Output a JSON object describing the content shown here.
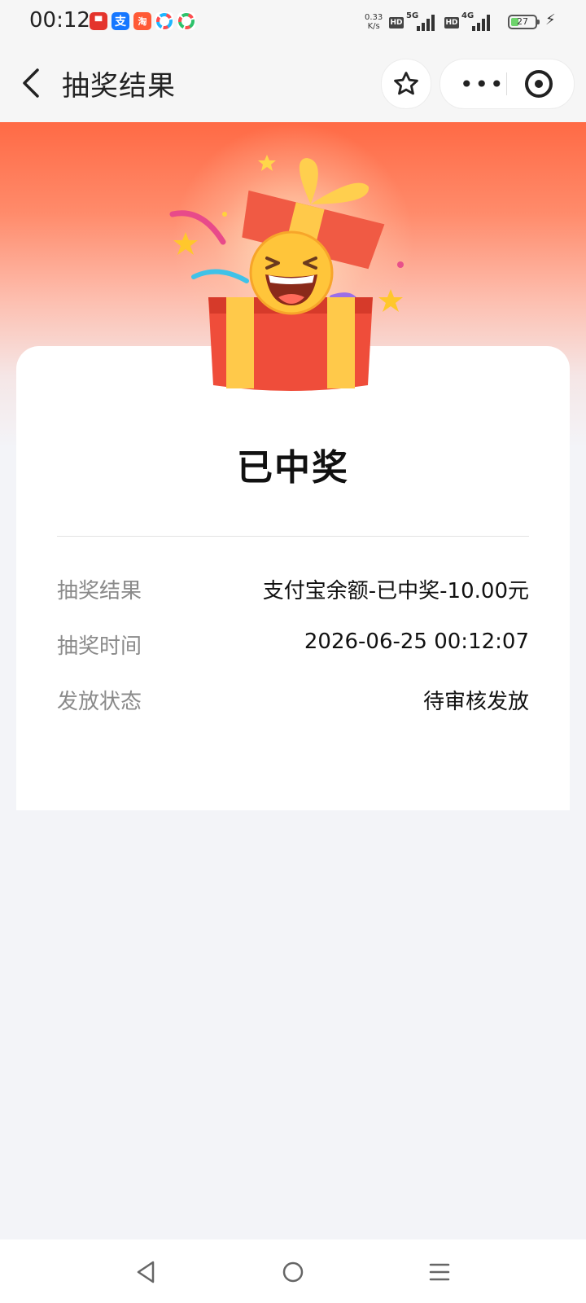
{
  "status_bar": {
    "time": "00:12",
    "net_speed_value": "0.33",
    "net_speed_unit": "K/s",
    "hd_label": "HD",
    "network_5g": "5G",
    "network_4g": "4G",
    "battery_percent": "27",
    "notification_icons": [
      "app-icon-red",
      "alipay-icon",
      "taobao-icon",
      "colorful-app-icon",
      "colorful-app-icon"
    ]
  },
  "header": {
    "title": "抽奖结果"
  },
  "result": {
    "headline": "已中奖",
    "rows": [
      {
        "label": "抽奖结果",
        "value": "支付宝余额-已中奖-10.00元"
      },
      {
        "label": "抽奖时间",
        "value": "2026-06-25 00:12:07"
      },
      {
        "label": "发放状态",
        "value": "待审核发放"
      }
    ]
  },
  "colors": {
    "hero_top": "#ff6a45",
    "page_bg": "#f3f4f8",
    "label_gray": "#8a8a8a"
  }
}
